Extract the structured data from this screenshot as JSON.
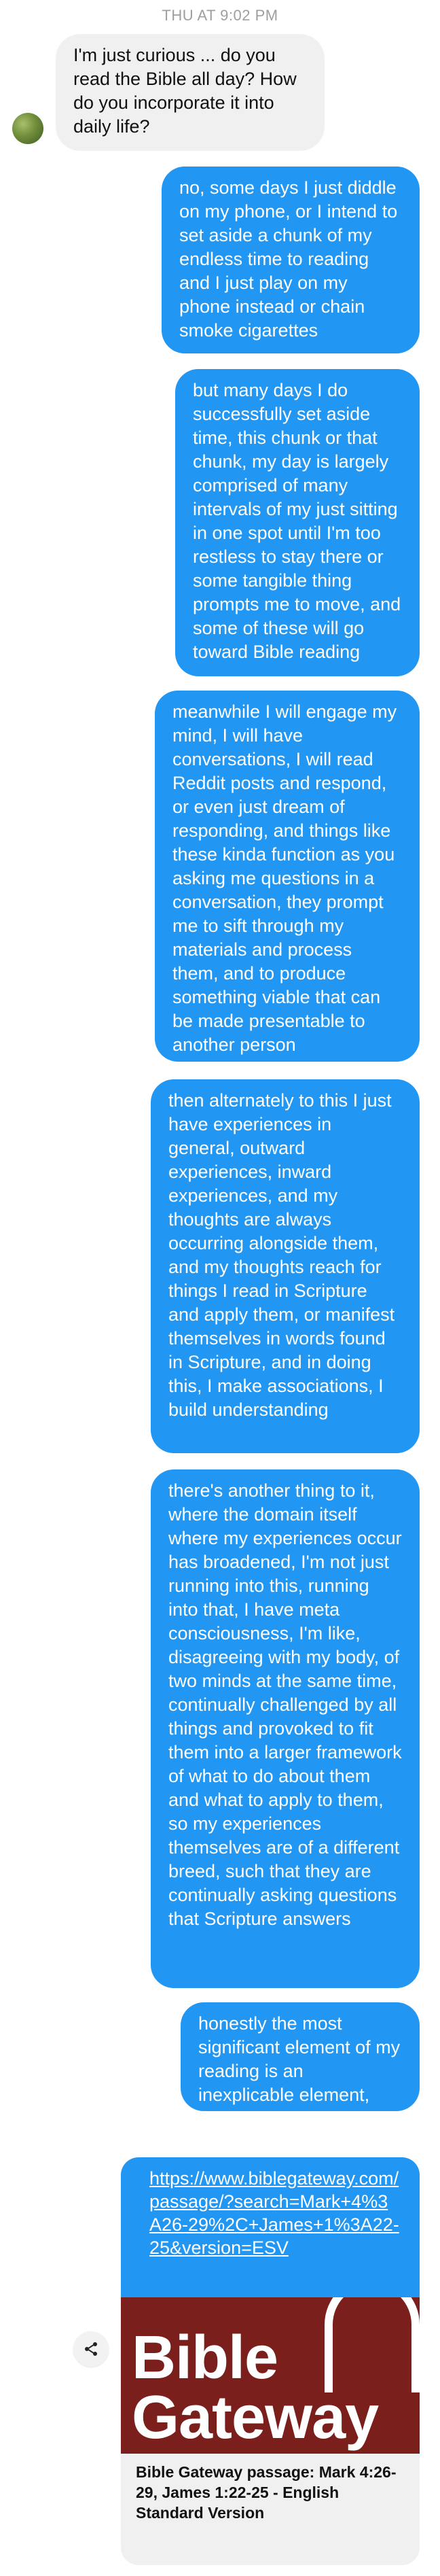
{
  "conversation": {
    "timestamp": "THU AT 9:02 PM",
    "incoming": [
      {
        "text": "I'm just curious ... do you read the Bible all day? How do you incorporate it into daily life?"
      }
    ],
    "outgoing": [
      {
        "text": "no, some days I just diddle on my phone, or I intend to set aside a chunk of my endless time to reading and I just play on my phone instead or chain smoke cigarettes"
      },
      {
        "text": "but many days I do successfully set aside time, this chunk or that chunk, my day is largely comprised of many intervals of my just sitting in one spot until I'm too restless to stay there or some tangible thing prompts me to move, and some of these will go toward Bible reading"
      },
      {
        "text": "meanwhile I will engage my mind, I will have conversations, I will read Reddit posts and respond, or even just dream of responding, and things like these kinda function as you asking me questions in a conversation, they prompt me to sift through my materials and process them, and to produce something viable that can be made presentable to another person"
      },
      {
        "text": "then alternately to this I just have experiences in general, outward experiences, inward experiences, and my thoughts are always occurring alongside them, and my thoughts reach for things I read in Scripture and apply them, or manifest themselves in words found in Scripture, and in doing this, I make associations, I build understanding"
      },
      {
        "text": "there's another thing to it, where the domain itself where my experiences occur has broadened, I'm not just running into this, running into that, I have meta consciousness, I'm like, disagreeing with my body, of two minds at the same time, continually challenged by all things and provoked to fit them into a larger framework of what to do about them and what to apply to them, so my experiences themselves are of a different breed, such that they are continually asking questions that Scripture answers"
      },
      {
        "text": "honestly the most significant element of my reading is an inexplicable element, something is just building itself all by itself"
      }
    ],
    "link": {
      "url": "https://www.biblegateway.com/passage/?search=Mark+4%3A26-29%2C+James+1%3A22-25&version=ESV",
      "preview_brand": "Bible Gateway",
      "preview_brand_line1": "Bible",
      "preview_brand_line2": "Gateway",
      "title": "Bible Gateway passage: Mark 4:26-29, James 1:22-25 - English Standard Version"
    }
  },
  "colors": {
    "outgoing_bubble": "#2196f3",
    "incoming_bubble": "#f0f0f0",
    "preview_background": "#7a1f1b"
  },
  "icons": {
    "share": "share-icon",
    "avatar": "avatar"
  }
}
